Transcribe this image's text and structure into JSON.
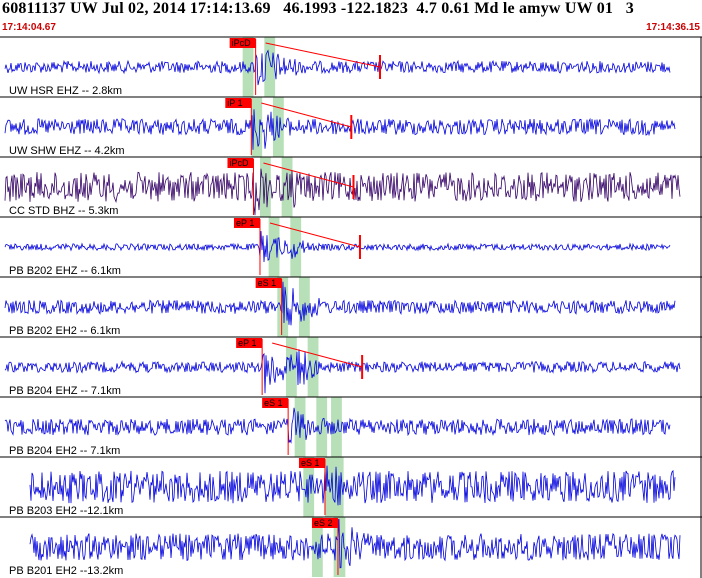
{
  "header": {
    "title": "60811137 UW Jul 02, 2014 17:14:13.69   46.1993 -122.1823  4.7 0.61 Md le amyw UW 01   3",
    "start_time": "17:14:04.67",
    "end_time": "17:14:36.15"
  },
  "colors": {
    "trace": "#0000dd",
    "trace_dark": "#330066",
    "pick": "#ff0000",
    "band": "#b8e0b8",
    "separator": "#000000"
  },
  "chart_data": {
    "type": "line",
    "x_range": [
      "17:14:04.67",
      "17:14:36.15"
    ],
    "grid": false,
    "traces": [
      {
        "label": "UW HSR EHZ -- 2.8km",
        "pick_label": "iPcD",
        "pick_time": 11.8,
        "s_time": 12.2,
        "amplitude": 0.22,
        "event_amp": 0.9,
        "color_key": "trace",
        "arrow": true
      },
      {
        "label": "UW SHW EHZ -- 4.2km",
        "pick_label": "iP 1",
        "pick_time": 11.6,
        "s_time": 12.2,
        "amplitude": 0.3,
        "event_amp": 0.9,
        "color_key": "trace",
        "arrow": true
      },
      {
        "label": "CC STD BHZ -- 5.3km",
        "pick_label": "iPcD",
        "pick_time": 11.7,
        "s_time": 13.4,
        "amplitude": 0.55,
        "event_amp": 1.0,
        "color_key": "trace_dark",
        "arrow": true
      },
      {
        "label": "PB B202 EHZ -- 6.1km",
        "pick_label": "eP 1",
        "pick_time": 12.0,
        "s_time": 13.3,
        "amplitude": 0.12,
        "event_amp": 0.6,
        "color_key": "trace",
        "arrow": true
      },
      {
        "label": "PB B202 EH2 -- 6.1km",
        "pick_label": "eS 1",
        "pick_time": 13.0,
        "s_time": 13.0,
        "amplitude": 0.25,
        "event_amp": 0.9,
        "color_key": "trace",
        "arrow": false
      },
      {
        "label": "PB B204 EHZ -- 7.1km",
        "pick_label": "eP 1",
        "pick_time": 12.1,
        "s_time": 13.7,
        "amplitude": 0.2,
        "event_amp": 1.0,
        "color_key": "trace",
        "arrow": true
      },
      {
        "label": "PB B204 EH2 -- 7.1km",
        "pick_label": "eS 1",
        "pick_time": 13.3,
        "s_time": 13.3,
        "amplitude": 0.3,
        "event_amp": 0.8,
        "color_key": "trace",
        "arrow": false
      },
      {
        "label": "PB B203 EH2 --12.1km",
        "pick_label": "eS 1",
        "pick_time": 15.0,
        "s_time": 15.0,
        "amplitude": 0.6,
        "event_amp": 1.0,
        "color_key": "trace",
        "arrow": false
      },
      {
        "label": "PB B201 EH2 --13.2km",
        "pick_label": "eS 2",
        "pick_time": 15.6,
        "s_time": 15.6,
        "amplitude": 0.5,
        "event_amp": 1.0,
        "color_key": "trace",
        "arrow": false
      }
    ],
    "bands": [
      {
        "start": 11.2,
        "end": 11.7
      },
      {
        "start": 12.2,
        "end": 12.7
      },
      {
        "start": 14.8,
        "end": 15.3
      }
    ]
  }
}
